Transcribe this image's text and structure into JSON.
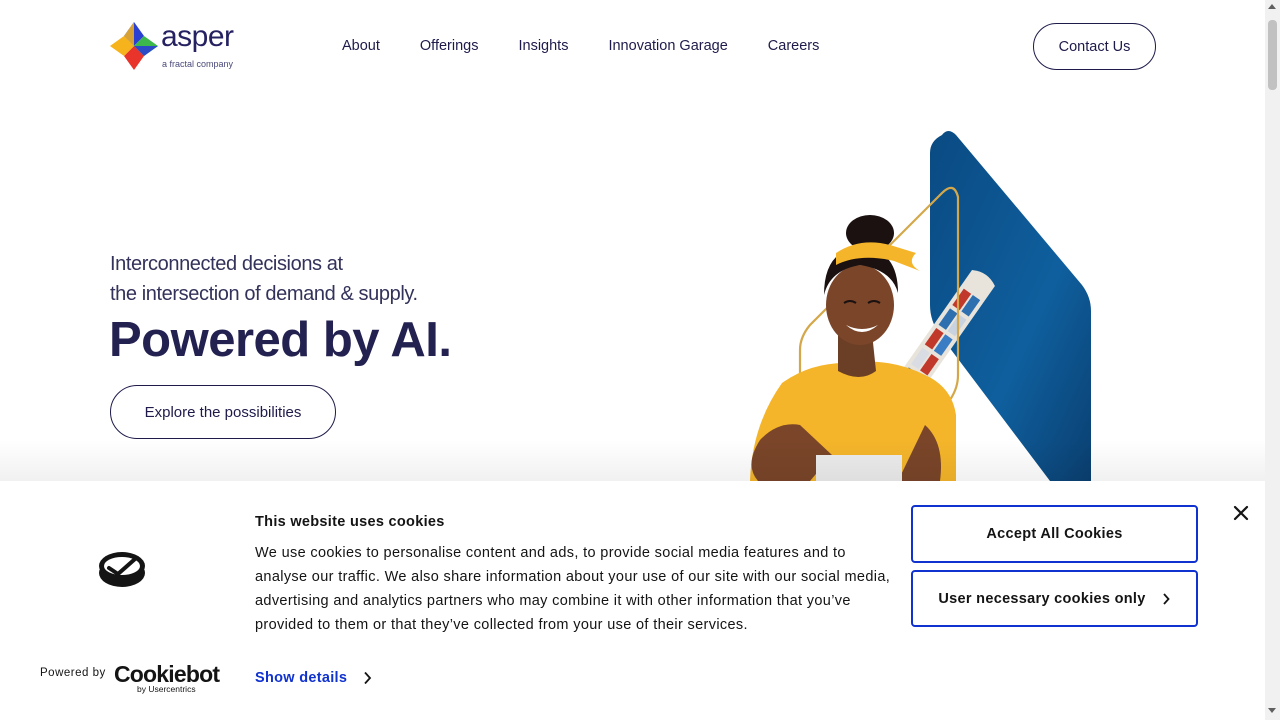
{
  "brand": {
    "name": "asper",
    "tagline": "a fractal company",
    "logo_colors": [
      "#2b3fd1",
      "#3db84a",
      "#e8342a",
      "#f6b31b"
    ]
  },
  "nav": {
    "items": [
      {
        "label": "About"
      },
      {
        "label": "Offerings"
      },
      {
        "label": "Insights"
      },
      {
        "label": "Innovation Garage"
      },
      {
        "label": "Careers"
      }
    ],
    "contact_label": "Contact Us"
  },
  "hero": {
    "subtitle_line1": "Interconnected decisions at",
    "subtitle_line2": "the intersection of demand & supply.",
    "title": "Powered by AI.",
    "cta_label": "Explore the possibilities",
    "accent_color": "#d4a84a",
    "ocean_color": "#0d4f86"
  },
  "cookie_banner": {
    "title": "This website uses cookies",
    "body": "We use cookies to personalise content and ads, to provide social media features and to analyse our traffic. We also share information about your use of our site with our social media, advertising and analytics partners who may combine it with other information that you’ve provided to them or that they’ve collected from your use of their services.",
    "show_details_label": "Show details",
    "accept_label": "Accept All Cookies",
    "necessary_label": "User necessary cookies only",
    "powered_by_label": "Powered by",
    "provider_name": "Cookiebot",
    "provider_sub": "by Usercentrics",
    "button_border_color": "#1032cf"
  }
}
